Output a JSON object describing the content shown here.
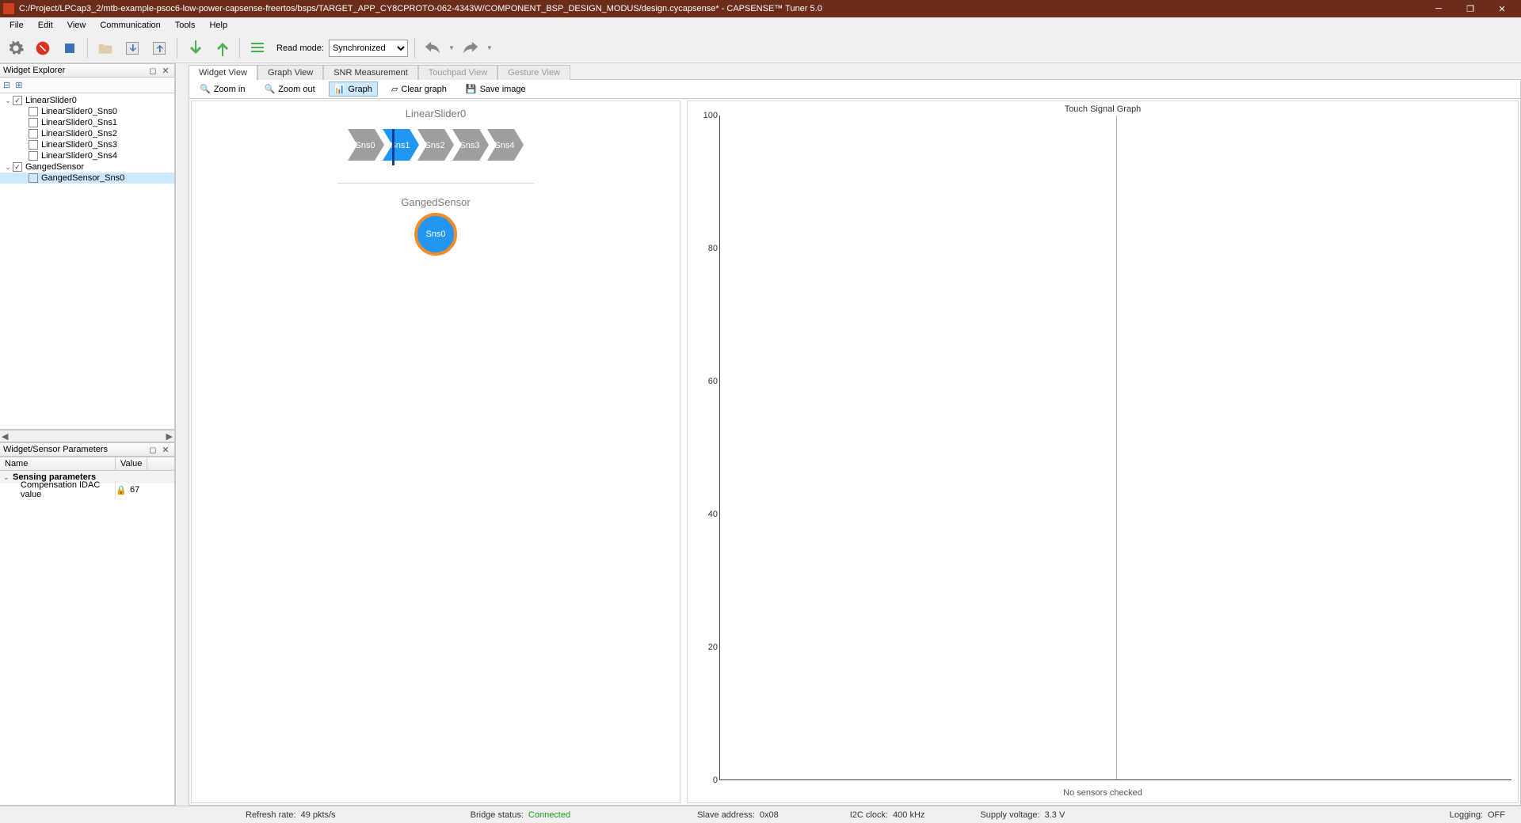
{
  "window": {
    "title": "C:/Project/LPCap3_2/mtb-example-psoc6-low-power-capsense-freertos/bsps/TARGET_APP_CY8CPROTO-062-4343W/COMPONENT_BSP_DESIGN_MODUS/design.cycapsense* - CAPSENSE™ Tuner 5.0"
  },
  "menu": [
    "File",
    "Edit",
    "View",
    "Communication",
    "Tools",
    "Help"
  ],
  "toolbar": {
    "readmode_label": "Read mode:",
    "readmode_value": "Synchronized"
  },
  "explorer": {
    "title": "Widget Explorer",
    "tree": [
      {
        "type": "widget",
        "name": "LinearSlider0",
        "checked": true,
        "expanded": true,
        "children": [
          {
            "name": "LinearSlider0_Sns0",
            "checked": false
          },
          {
            "name": "LinearSlider0_Sns1",
            "checked": false
          },
          {
            "name": "LinearSlider0_Sns2",
            "checked": false
          },
          {
            "name": "LinearSlider0_Sns3",
            "checked": false
          },
          {
            "name": "LinearSlider0_Sns4",
            "checked": false
          }
        ]
      },
      {
        "type": "widget",
        "name": "GangedSensor",
        "checked": true,
        "expanded": true,
        "children": [
          {
            "name": "GangedSensor_Sns0",
            "checked": false,
            "selected": true
          }
        ]
      }
    ]
  },
  "params": {
    "title": "Widget/Sensor Parameters",
    "col_name": "Name",
    "col_value": "Value",
    "group": "Sensing parameters",
    "rows": [
      {
        "name": "Compensation IDAC value",
        "value": "67"
      }
    ]
  },
  "tabs": [
    {
      "label": "Widget View",
      "active": true
    },
    {
      "label": "Graph View"
    },
    {
      "label": "SNR Measurement"
    },
    {
      "label": "Touchpad View",
      "disabled": true
    },
    {
      "label": "Gesture View",
      "disabled": true
    }
  ],
  "subtoolbar": {
    "zoom_in": "Zoom in",
    "zoom_out": "Zoom out",
    "graph": "Graph",
    "clear": "Clear graph",
    "save": "Save image"
  },
  "widgets": {
    "slider": {
      "title": "LinearSlider0",
      "sensors": [
        "Sns0",
        "Sns1",
        "Sns2",
        "Sns3",
        "Sns4"
      ],
      "active_index": 1
    },
    "ganged": {
      "title": "GangedSensor",
      "sensor": "Sns0",
      "active": true,
      "selected": true
    }
  },
  "graph": {
    "title": "Touch Signal Graph",
    "footer": "No sensors checked"
  },
  "chart_data": {
    "type": "line",
    "title": "Touch Signal Graph",
    "xlabel": "",
    "ylabel": "",
    "ylim": [
      0,
      100
    ],
    "yticks": [
      0,
      20,
      40,
      60,
      80,
      100
    ],
    "series": [],
    "note": "No sensors checked"
  },
  "status": {
    "refresh_label": "Refresh rate:",
    "refresh_value": "49 pkts/s",
    "bridge_label": "Bridge status:",
    "bridge_value": "Connected",
    "slave_label": "Slave address:",
    "slave_value": "0x08",
    "i2c_label": "I2C clock:",
    "i2c_value": "400 kHz",
    "supply_label": "Supply voltage:",
    "supply_value": "3.3 V",
    "log_label": "Logging:",
    "log_value": "OFF"
  }
}
